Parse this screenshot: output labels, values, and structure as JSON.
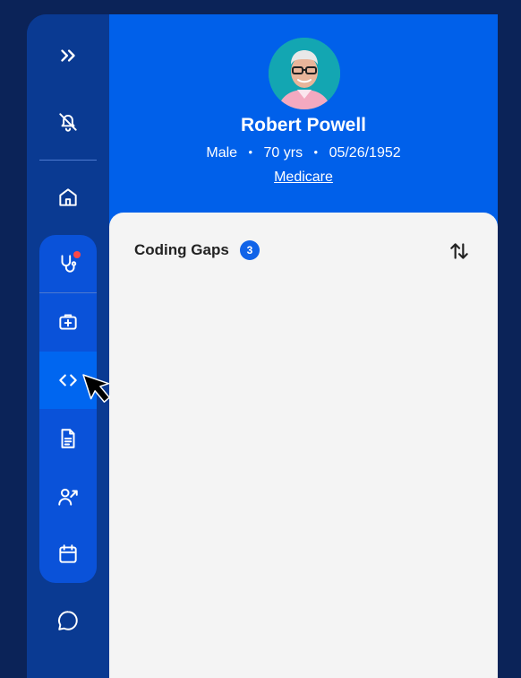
{
  "sidebar": {
    "items": [
      {
        "name": "expand",
        "icon": "chevrons-right-icon"
      },
      {
        "name": "notifications",
        "icon": "bell-off-icon"
      },
      {
        "name": "home",
        "icon": "home-icon"
      },
      {
        "name": "care",
        "icon": "stethoscope-icon",
        "has_alert": true
      },
      {
        "name": "medical",
        "icon": "medical-kit-icon"
      },
      {
        "name": "coding",
        "icon": "code-icon",
        "active": true
      },
      {
        "name": "documents",
        "icon": "document-icon"
      },
      {
        "name": "referrals",
        "icon": "user-referral-icon"
      },
      {
        "name": "calendar",
        "icon": "calendar-icon"
      },
      {
        "name": "chat",
        "icon": "chat-icon"
      }
    ]
  },
  "patient": {
    "name": "Robert Powell",
    "gender": "Male",
    "age": "70 yrs",
    "dob": "05/26/1952",
    "insurance": "Medicare",
    "separator": "•"
  },
  "panel": {
    "title": "Coding Gaps",
    "count": "3",
    "sort_icon": "sort-arrows-icon"
  },
  "colors": {
    "background": "#0b2358",
    "sidebar": "#0a3a92",
    "sidebar_group": "#0a52d9",
    "active_item": "#0066f0",
    "header": "#0060ea",
    "card": "#f4f4f4",
    "badge": "#1063e8",
    "alert": "#ff4747"
  }
}
